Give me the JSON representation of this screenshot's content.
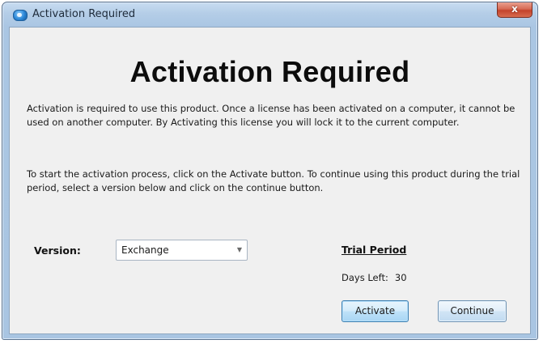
{
  "window": {
    "title": "Activation Required",
    "close_glyph": "x",
    "app_icon": "app-icon"
  },
  "dialog": {
    "heading": "Activation Required",
    "paragraph1": "Activation is required to use this product.  Once a license has been activated on a computer, it cannot be used on another computer.  By Activating this license you will lock it to the current computer.",
    "paragraph2": "To start the activation process, click on the Activate button.  To continue using this product during the trial period, select a version below and click on the continue button."
  },
  "version": {
    "label": "Version:",
    "selected": "Exchange",
    "dropdown_icon": "chevron-down-icon"
  },
  "trial": {
    "title": "Trial Period",
    "days_left_label": "Days Left:",
    "days_left_value": "30"
  },
  "buttons": {
    "activate": "Activate",
    "continue": "Continue"
  }
}
